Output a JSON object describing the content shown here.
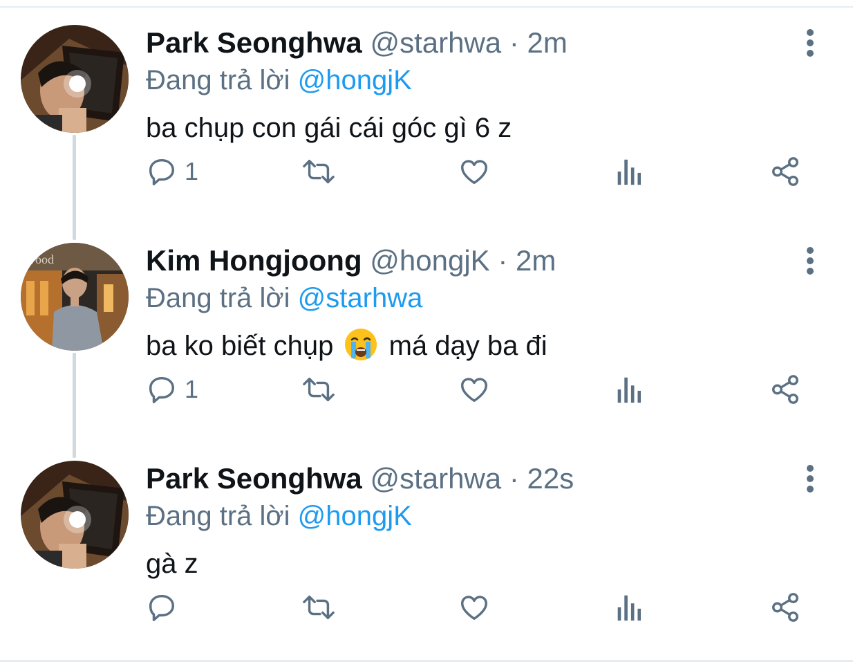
{
  "reply_prefix": "Đang trả lời",
  "separator": "·",
  "colors": {
    "name": "#0f1419",
    "muted": "#5b7083",
    "mention": "#1d9bf0",
    "thread_line": "#cfd9de"
  },
  "tweets": [
    {
      "name": "Park Seonghwa",
      "handle": "@starhwa",
      "time": "2m",
      "reply_to": "@hongjK",
      "text_before": "ba chụp con gái cái góc gì 6 z",
      "emoji": "",
      "text_after": "",
      "reply_count": "1",
      "avatar": "avatar-seonghwa"
    },
    {
      "name": "Kim Hongjoong",
      "handle": "@hongjK",
      "time": "2m",
      "reply_to": "@starhwa",
      "text_before": "ba ko biết chụp",
      "emoji": "loudly-crying-face",
      "text_after": "má dạy ba đi",
      "reply_count": "1",
      "avatar": "avatar-hongjoong"
    },
    {
      "name": "Park Seonghwa",
      "handle": "@starhwa",
      "time": "22s",
      "reply_to": "@hongjK",
      "text_before": "gà z",
      "emoji": "",
      "text_after": "",
      "reply_count": "",
      "avatar": "avatar-seonghwa"
    }
  ]
}
